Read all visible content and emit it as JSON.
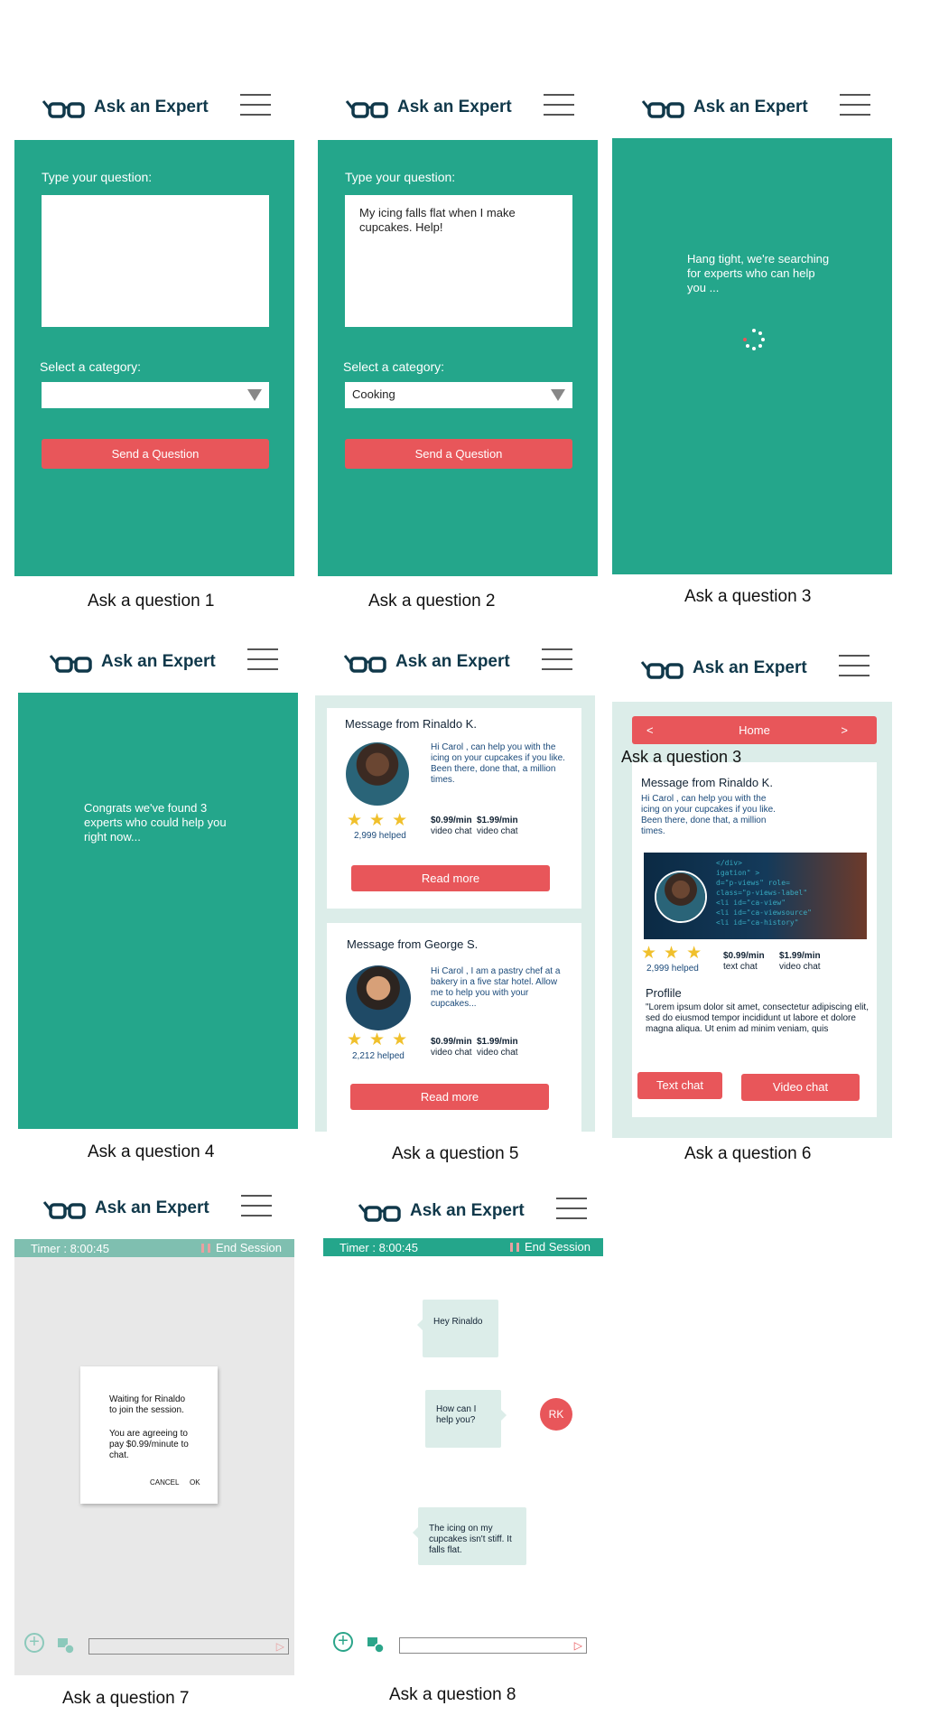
{
  "app": {
    "brand": "Ask an Expert"
  },
  "colors": {
    "teal": "#24a68b",
    "mint": "#dcede9",
    "red": "#e8565a",
    "navy": "#10384a",
    "star": "#f0c02c"
  },
  "screens": {
    "s1": {
      "caption": "Ask a question 1",
      "question_label": "Type your question:",
      "question_value": "",
      "category_label": "Select a category:",
      "category_value": "",
      "button": "Send a Question"
    },
    "s2": {
      "caption": "Ask a question 2",
      "question_label": "Type your question:",
      "question_value": "My icing falls flat when I make cupcakes. Help!",
      "category_label": "Select a category:",
      "category_value": "Cooking",
      "button": "Send a Question"
    },
    "s3": {
      "caption": "Ask a question 3",
      "message": "Hang tight, we're searching for experts who can help you ..."
    },
    "s4": {
      "caption": "Ask a question 4",
      "message": "Congrats we've found 3 experts who could help you right now..."
    },
    "s5": {
      "caption": "Ask a question 5",
      "cards": [
        {
          "from": "Message from Rinaldo K.",
          "blurb": "Hi Carol , can help you with the icing on your cupcakes if you like. Been there, done that, a million times.",
          "helped": "2,999 helped",
          "price1": "$0.99/min",
          "price1_sub": "video chat",
          "price2": "$1.99/min",
          "price2_sub": "video chat",
          "button": "Read more"
        },
        {
          "from": "Message from George S.",
          "blurb": "Hi Carol , I am a pastry chef at a bakery in a five star hotel. Allow me to help you with your cupcakes...",
          "helped": "2,212 helped",
          "price1": "$0.99/min",
          "price1_sub": "video chat",
          "price2": "$1.99/min",
          "price2_sub": "video chat",
          "button": "Read more"
        }
      ]
    },
    "s6": {
      "caption": "Ask a question 6",
      "nav_prev": "<",
      "nav_title": "Home",
      "nav_next": ">",
      "overlay_caption": "Ask a question 3",
      "from": "Message from Rinaldo K.",
      "blurb": "Hi Carol , can help you with the icing on your cupcakes if you like. Been there, done that, a million times.",
      "helped": "2,999 helped",
      "price1": "$0.99/min",
      "price1_sub": "text chat",
      "price2": "$1.99/min",
      "price2_sub": "video chat",
      "profile_title": "Proflile",
      "profile_text": "\"Lorem ipsum dolor sit amet, consectetur adipiscing elit, sed do eiusmod tempor incididunt ut labore et dolore magna aliqua. Ut enim ad minim veniam, quis",
      "text_chat": "Text chat",
      "video_chat": "Video chat"
    },
    "s7": {
      "caption": "Ask a question 7",
      "timer": "Timer : 8:00:45",
      "end": "End Session",
      "dialog_line1": "Waiting for Rinaldo to join the session.",
      "dialog_line2": "You are agreeing to pay $0.99/minute to chat.",
      "cancel": "CANCEL",
      "ok": "OK"
    },
    "s8": {
      "caption": "Ask a question 8",
      "timer": "Timer : 8:00:45",
      "end": "End Session",
      "msg1": "Hey Rinaldo",
      "msg2": "How can I help you?",
      "avatar_initials": "RK",
      "msg3": "The icing on my cupcakes isn't stiff. It falls flat."
    }
  }
}
